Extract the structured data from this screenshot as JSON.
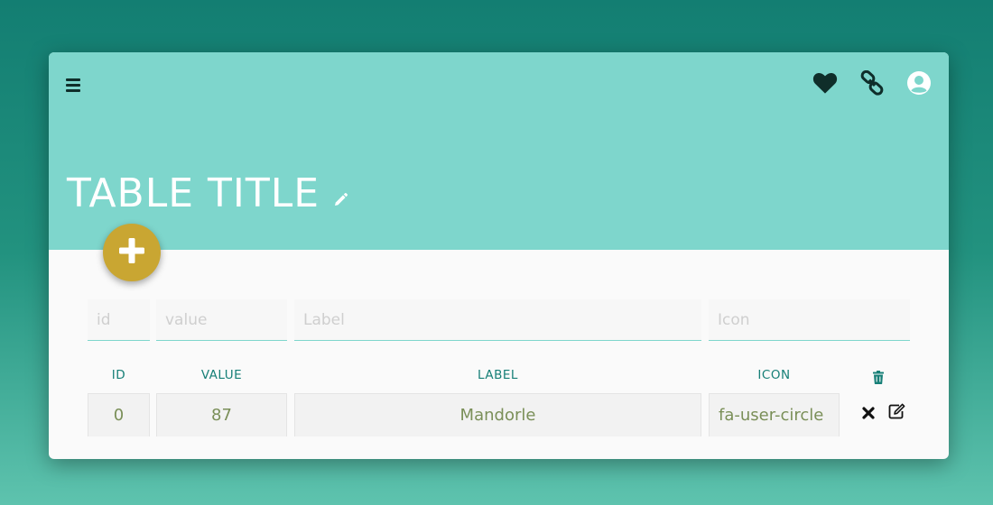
{
  "header": {
    "title": "TABLE TITLE",
    "icons": [
      "menu-icon",
      "heart-icon",
      "link-icon",
      "user-circle-icon",
      "pencil-icon"
    ]
  },
  "fab": {
    "icon": "plus-icon"
  },
  "form": {
    "id_placeholder": "id",
    "value_placeholder": "value",
    "label_placeholder": "Label",
    "icon_placeholder": "Icon"
  },
  "table": {
    "columns": [
      "ID",
      "VALUE",
      "LABEL",
      "ICON"
    ],
    "header_icon": "trash-icon",
    "rows": [
      {
        "id": "0",
        "value": "87",
        "label": "Mandorle",
        "icon": "fa-user-circle"
      }
    ],
    "row_actions": [
      "times-icon",
      "edit-icon"
    ]
  },
  "colors": {
    "header_bg": "#7ed6cc",
    "accent": "#167f77",
    "fab": "#c9a632",
    "cell_text": "#7a8f58"
  }
}
